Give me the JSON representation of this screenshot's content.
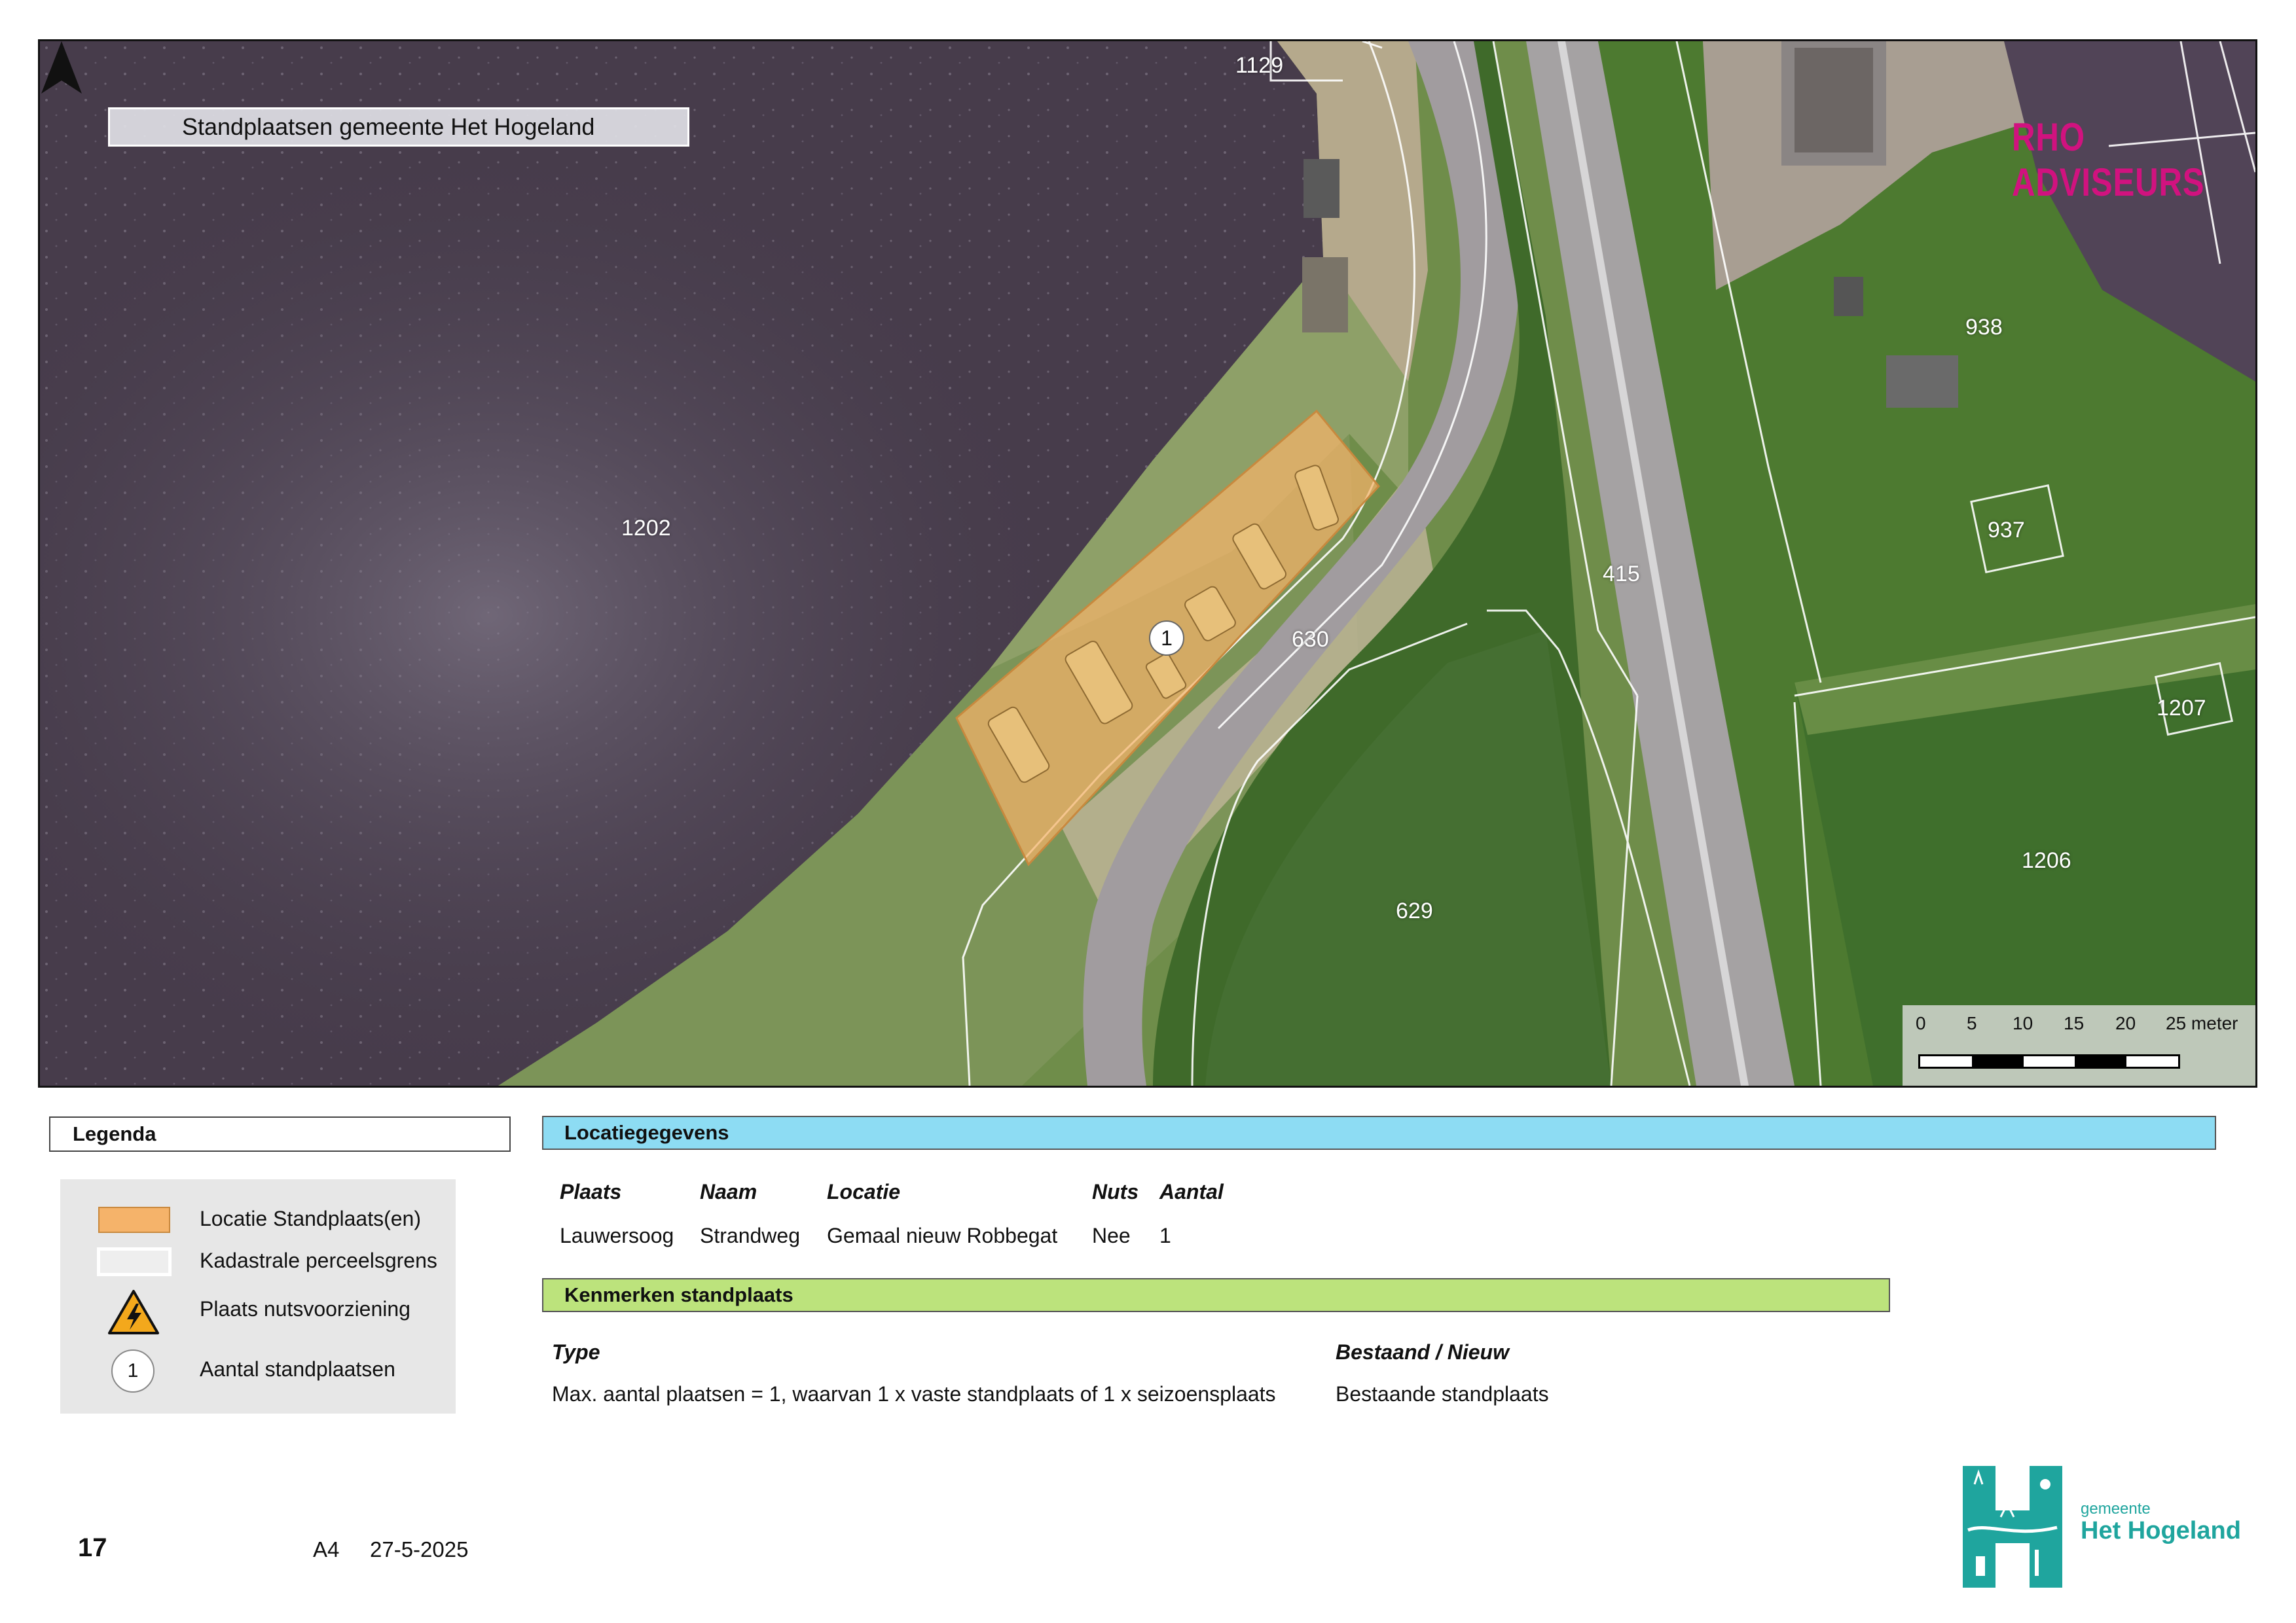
{
  "map": {
    "title": "Standplaatsen gemeente Het Hogeland",
    "brand": "RHO ADVISEURS",
    "parcels": [
      "1129",
      "938",
      "1202",
      "937",
      "415",
      "630",
      "1207",
      "1206",
      "629"
    ],
    "standplaats_count": "1",
    "scale": {
      "ticks": [
        "0",
        "5",
        "10",
        "15",
        "20",
        "25 meter"
      ]
    },
    "north_icon": "north-arrow-icon"
  },
  "legend": {
    "title": "Legenda",
    "items": [
      {
        "label": "Locatie Standplaats(en)",
        "color": "#f5b36a"
      },
      {
        "label": "Kadastrale perceelsgrens",
        "color": "#ffffff"
      },
      {
        "label": "Plaats nutsvoorziening",
        "icon": "electricity-warning-icon"
      },
      {
        "label": "Aantal standplaatsen",
        "symbol": "1"
      }
    ]
  },
  "locatie": {
    "title": "Locatiegegevens",
    "color": "#8ddcf3",
    "headers": [
      "Plaats",
      "Naam",
      "Locatie",
      "Nuts",
      "Aantal"
    ],
    "row": [
      "Lauwersoog",
      "Strandweg",
      "Gemaal nieuw Robbegat",
      "Nee",
      "1"
    ]
  },
  "kenmerken": {
    "title": "Kenmerken standplaats",
    "color": "#bce37c",
    "headers": [
      "Type",
      "Bestaand / Nieuw"
    ],
    "row": [
      "Max. aantal plaatsen = 1, waarvan 1 x vaste standplaats of 1 x seizoensplaats",
      "Bestaande standplaats"
    ]
  },
  "footer": {
    "page": "17",
    "format": "A4",
    "date": "27-5-2025"
  },
  "logo": {
    "line1": "gemeente",
    "line2": "Het Hogeland",
    "color": "#1fa59e"
  }
}
